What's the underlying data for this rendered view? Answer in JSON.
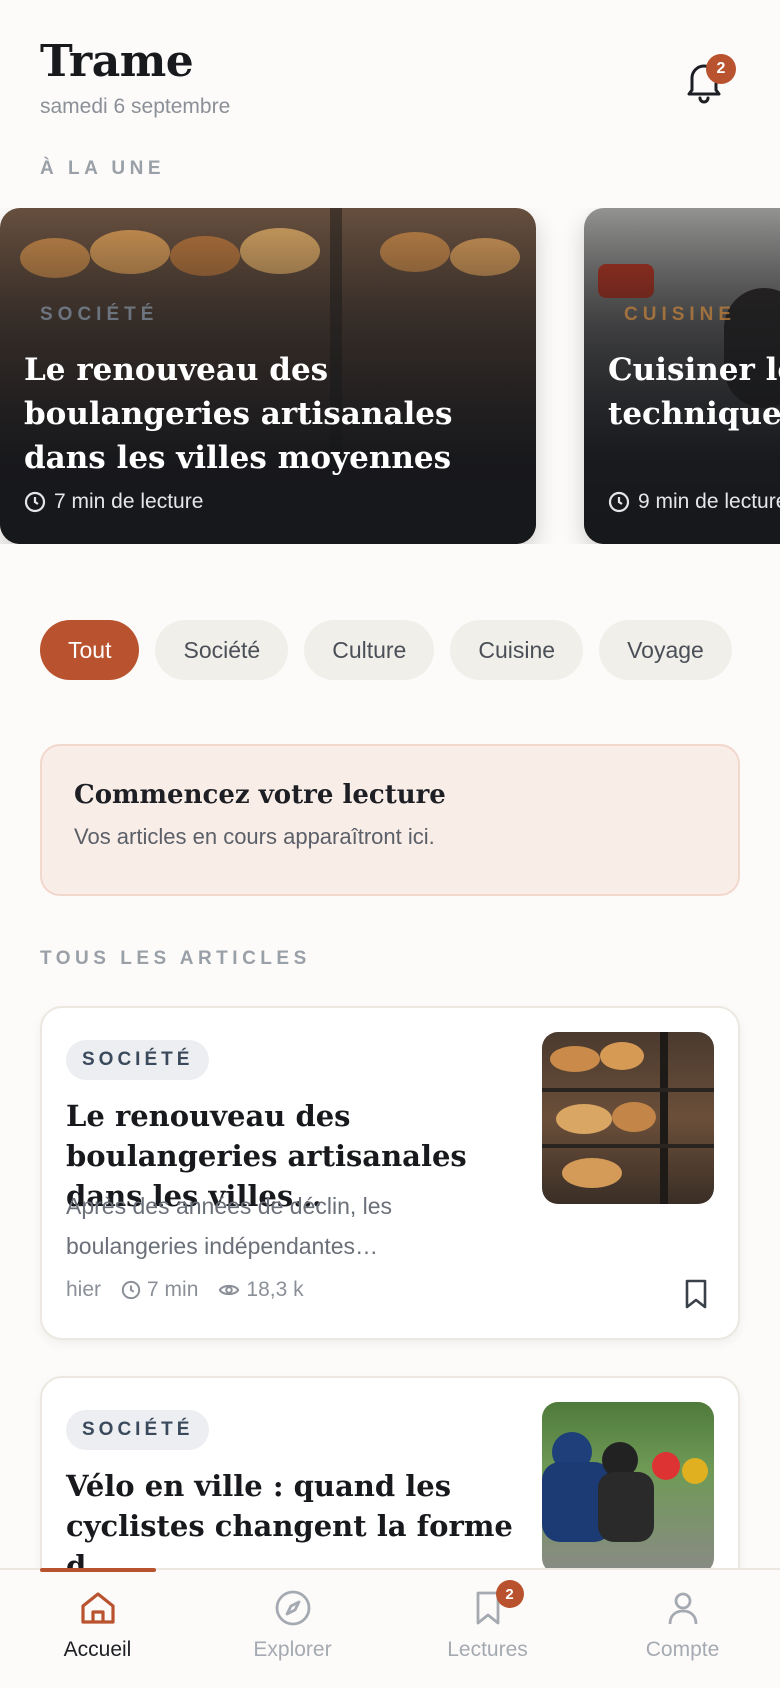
{
  "header": {
    "title": "Trame",
    "date": "samedi 6 septembre",
    "notifications_count": "2"
  },
  "featured": {
    "section_label": "À LA UNE",
    "cards": [
      {
        "category": "SOCIÉTÉ",
        "category_color": "#8fa3b8",
        "title": "Le renouveau des boulangeries artisanales dans les villes moyennes",
        "read_time": "7 min de lecture"
      },
      {
        "category": "CUISINE",
        "category_color": "#c8843a",
        "title": "Cuisiner les restes : les techniques pour tout",
        "read_time": "9 min de lecture"
      }
    ]
  },
  "filters": {
    "chips": [
      "Tout",
      "Société",
      "Culture",
      "Cuisine",
      "Voyage"
    ],
    "active": "Tout"
  },
  "continue_reading": {
    "title": "Commencez votre lecture",
    "subtitle": "Vos articles en cours apparaîtront ici."
  },
  "articles": {
    "section_label": "TOUS LES ARTICLES",
    "items": [
      {
        "category": "SOCIÉTÉ",
        "title": "Le renouveau des boulangeries artisanales dans les villes…",
        "excerpt": "Après des années de déclin, les boulangeries indépendantes…",
        "date": "hier",
        "read_time": "7 min",
        "views": "18,3 k",
        "thumb": "pastry-icon"
      },
      {
        "category": "SOCIÉTÉ",
        "title": "Vélo en ville : quand les cyclistes changent la forme d…",
        "excerpt": "",
        "date": "",
        "read_time": "",
        "views": "",
        "thumb": "cyclists-icon"
      }
    ]
  },
  "nav": {
    "items": [
      {
        "label": "Accueil",
        "icon": "home-icon"
      },
      {
        "label": "Explorer",
        "icon": "compass-icon"
      },
      {
        "label": "Lectures",
        "icon": "bookmark-icon",
        "badge": "2"
      },
      {
        "label": "Compte",
        "icon": "user-icon"
      }
    ],
    "active": "Accueil"
  },
  "colors": {
    "accent": "#b9532f",
    "background": "#fcfbf9"
  }
}
